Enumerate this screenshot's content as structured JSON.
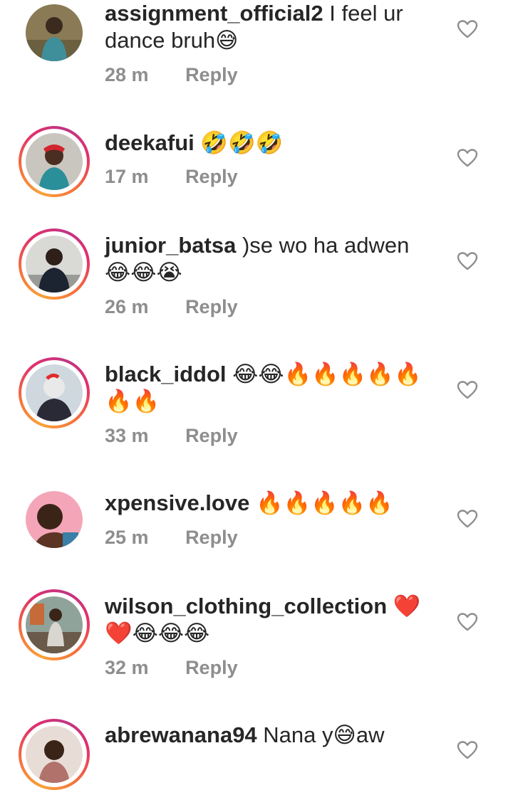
{
  "comments": [
    {
      "username": "assignment_official2",
      "text": "I feel ur dance bruh😅",
      "time": "28 m",
      "reply": "Reply"
    },
    {
      "username": "deekafui",
      "text": "🤣🤣🤣",
      "time": "17 m",
      "reply": "Reply"
    },
    {
      "username": "junior_batsa",
      "text": ")se wo ha adwen 😂😂😭",
      "time": "26 m",
      "reply": "Reply"
    },
    {
      "username": "black_iddol",
      "text": "😂😂🔥🔥🔥🔥🔥🔥🔥",
      "time": "33 m",
      "reply": "Reply"
    },
    {
      "username": "xpensive.love",
      "text": "🔥🔥🔥🔥🔥",
      "time": "25 m",
      "reply": "Reply"
    },
    {
      "username": "wilson_clothing_collection",
      "text": "❤️❤️😂😂😂",
      "time": "32 m",
      "reply": "Reply"
    },
    {
      "username": "abrewanana94",
      "text": "Nana y😅aw",
      "time": "",
      "reply": ""
    }
  ],
  "icons": {
    "like": "heart-outline-icon"
  },
  "colors": {
    "text": "#262626",
    "meta": "#8e8e8e",
    "ring_start": "#f9a13a",
    "ring_end": "#c13584"
  }
}
